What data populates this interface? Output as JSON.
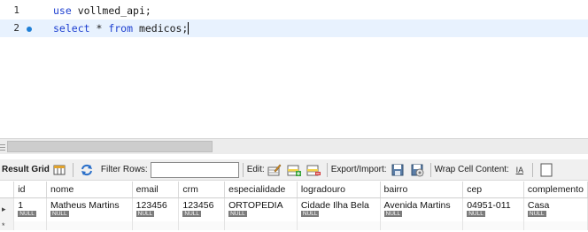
{
  "editor": {
    "lines": [
      {
        "number": "1",
        "keyword": "use",
        "rest": " vollmed_api;"
      },
      {
        "number": "2",
        "keyword": "select",
        "mid": " * ",
        "keyword2": "from",
        "rest": " medicos;"
      }
    ]
  },
  "toolbar": {
    "result_grid_label": "Result Grid",
    "filter_rows_label": "Filter Rows:",
    "filter_value": "",
    "edit_label": "Edit:",
    "export_import_label": "Export/Import:",
    "wrap_cell_label": "Wrap Cell Content:",
    "wrap_icon_text": "IA"
  },
  "grid": {
    "columns": [
      "id",
      "nome",
      "email",
      "crm",
      "especialidade",
      "logradouro",
      "bairro",
      "cep",
      "complemento"
    ],
    "rows": [
      {
        "marker": "▸",
        "cells": [
          "1",
          "Matheus Martins",
          "123456",
          "123456",
          "ORTOPEDIA",
          "Cidade Ilha Bela",
          "Avenida Martins",
          "04951-011",
          "Casa"
        ],
        "nulls": [
          "NULL",
          "NULL",
          "NULL",
          "NULL",
          "NULL",
          "NULL",
          "NULL",
          "NULL",
          "NULL"
        ]
      }
    ],
    "new_row_marker": "*",
    "null_text": "NULL"
  }
}
